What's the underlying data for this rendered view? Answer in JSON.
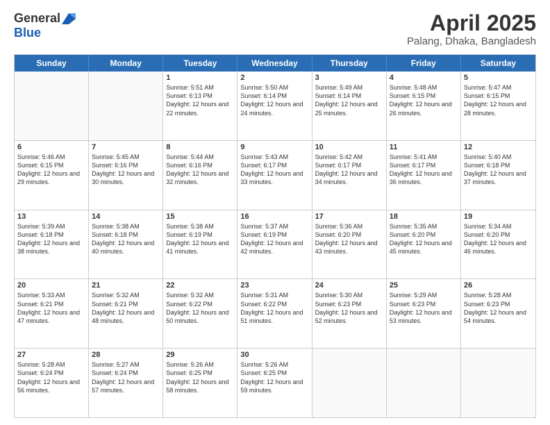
{
  "header": {
    "logo_general": "General",
    "logo_blue": "Blue",
    "title": "April 2025",
    "location": "Palang, Dhaka, Bangladesh"
  },
  "days_of_week": [
    "Sunday",
    "Monday",
    "Tuesday",
    "Wednesday",
    "Thursday",
    "Friday",
    "Saturday"
  ],
  "weeks": [
    [
      {
        "day": "",
        "info": ""
      },
      {
        "day": "",
        "info": ""
      },
      {
        "day": "1",
        "info": "Sunrise: 5:51 AM\nSunset: 6:13 PM\nDaylight: 12 hours and 22 minutes."
      },
      {
        "day": "2",
        "info": "Sunrise: 5:50 AM\nSunset: 6:14 PM\nDaylight: 12 hours and 24 minutes."
      },
      {
        "day": "3",
        "info": "Sunrise: 5:49 AM\nSunset: 6:14 PM\nDaylight: 12 hours and 25 minutes."
      },
      {
        "day": "4",
        "info": "Sunrise: 5:48 AM\nSunset: 6:15 PM\nDaylight: 12 hours and 26 minutes."
      },
      {
        "day": "5",
        "info": "Sunrise: 5:47 AM\nSunset: 6:15 PM\nDaylight: 12 hours and 28 minutes."
      }
    ],
    [
      {
        "day": "6",
        "info": "Sunrise: 5:46 AM\nSunset: 6:15 PM\nDaylight: 12 hours and 29 minutes."
      },
      {
        "day": "7",
        "info": "Sunrise: 5:45 AM\nSunset: 6:16 PM\nDaylight: 12 hours and 30 minutes."
      },
      {
        "day": "8",
        "info": "Sunrise: 5:44 AM\nSunset: 6:16 PM\nDaylight: 12 hours and 32 minutes."
      },
      {
        "day": "9",
        "info": "Sunrise: 5:43 AM\nSunset: 6:17 PM\nDaylight: 12 hours and 33 minutes."
      },
      {
        "day": "10",
        "info": "Sunrise: 5:42 AM\nSunset: 6:17 PM\nDaylight: 12 hours and 34 minutes."
      },
      {
        "day": "11",
        "info": "Sunrise: 5:41 AM\nSunset: 6:17 PM\nDaylight: 12 hours and 36 minutes."
      },
      {
        "day": "12",
        "info": "Sunrise: 5:40 AM\nSunset: 6:18 PM\nDaylight: 12 hours and 37 minutes."
      }
    ],
    [
      {
        "day": "13",
        "info": "Sunrise: 5:39 AM\nSunset: 6:18 PM\nDaylight: 12 hours and 38 minutes."
      },
      {
        "day": "14",
        "info": "Sunrise: 5:38 AM\nSunset: 6:18 PM\nDaylight: 12 hours and 40 minutes."
      },
      {
        "day": "15",
        "info": "Sunrise: 5:38 AM\nSunset: 6:19 PM\nDaylight: 12 hours and 41 minutes."
      },
      {
        "day": "16",
        "info": "Sunrise: 5:37 AM\nSunset: 6:19 PM\nDaylight: 12 hours and 42 minutes."
      },
      {
        "day": "17",
        "info": "Sunrise: 5:36 AM\nSunset: 6:20 PM\nDaylight: 12 hours and 43 minutes."
      },
      {
        "day": "18",
        "info": "Sunrise: 5:35 AM\nSunset: 6:20 PM\nDaylight: 12 hours and 45 minutes."
      },
      {
        "day": "19",
        "info": "Sunrise: 5:34 AM\nSunset: 6:20 PM\nDaylight: 12 hours and 46 minutes."
      }
    ],
    [
      {
        "day": "20",
        "info": "Sunrise: 5:33 AM\nSunset: 6:21 PM\nDaylight: 12 hours and 47 minutes."
      },
      {
        "day": "21",
        "info": "Sunrise: 5:32 AM\nSunset: 6:21 PM\nDaylight: 12 hours and 48 minutes."
      },
      {
        "day": "22",
        "info": "Sunrise: 5:32 AM\nSunset: 6:22 PM\nDaylight: 12 hours and 50 minutes."
      },
      {
        "day": "23",
        "info": "Sunrise: 5:31 AM\nSunset: 6:22 PM\nDaylight: 12 hours and 51 minutes."
      },
      {
        "day": "24",
        "info": "Sunrise: 5:30 AM\nSunset: 6:23 PM\nDaylight: 12 hours and 52 minutes."
      },
      {
        "day": "25",
        "info": "Sunrise: 5:29 AM\nSunset: 6:23 PM\nDaylight: 12 hours and 53 minutes."
      },
      {
        "day": "26",
        "info": "Sunrise: 5:28 AM\nSunset: 6:23 PM\nDaylight: 12 hours and 54 minutes."
      }
    ],
    [
      {
        "day": "27",
        "info": "Sunrise: 5:28 AM\nSunset: 6:24 PM\nDaylight: 12 hours and 56 minutes."
      },
      {
        "day": "28",
        "info": "Sunrise: 5:27 AM\nSunset: 6:24 PM\nDaylight: 12 hours and 57 minutes."
      },
      {
        "day": "29",
        "info": "Sunrise: 5:26 AM\nSunset: 6:25 PM\nDaylight: 12 hours and 58 minutes."
      },
      {
        "day": "30",
        "info": "Sunrise: 5:26 AM\nSunset: 6:25 PM\nDaylight: 12 hours and 59 minutes."
      },
      {
        "day": "",
        "info": ""
      },
      {
        "day": "",
        "info": ""
      },
      {
        "day": "",
        "info": ""
      }
    ]
  ]
}
